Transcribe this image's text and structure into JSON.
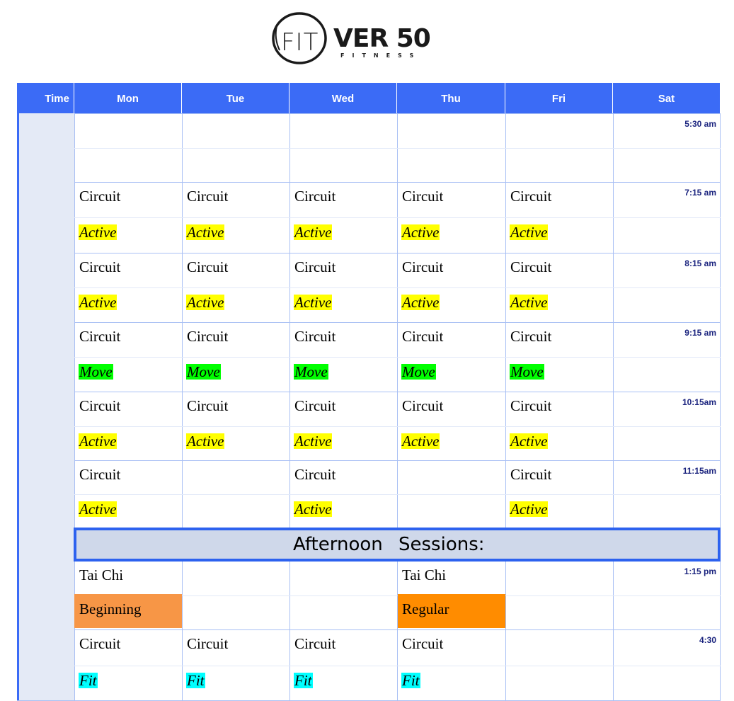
{
  "logo": {
    "fit": "FIT",
    "ver": "VER 50",
    "sub": "FITNESS"
  },
  "columns": [
    "Time",
    "Mon",
    "Tue",
    "Wed",
    "Thu",
    "Fri",
    "Sat"
  ],
  "times": [
    "5:30 am",
    "7:15 am",
    "8:15 am",
    "9:15 am",
    "10:15am",
    "11:15am",
    "1:15 pm",
    "4:30"
  ],
  "classes": {
    "circuit": "Circuit",
    "active": "Active",
    "move": "Move",
    "fit": "Fit",
    "tai_chi": "Tai Chi",
    "beginning": "Beginning",
    "regular": "Regular"
  },
  "afternoon_label": "Afternoon Sessions:",
  "colors": {
    "header": "#3b6bf6",
    "active": "#ffff00",
    "move": "#00ff00",
    "fit": "#00ffff",
    "beginning": "#f79646",
    "regular": "#ff8c00",
    "band": "#cfd8ea"
  }
}
